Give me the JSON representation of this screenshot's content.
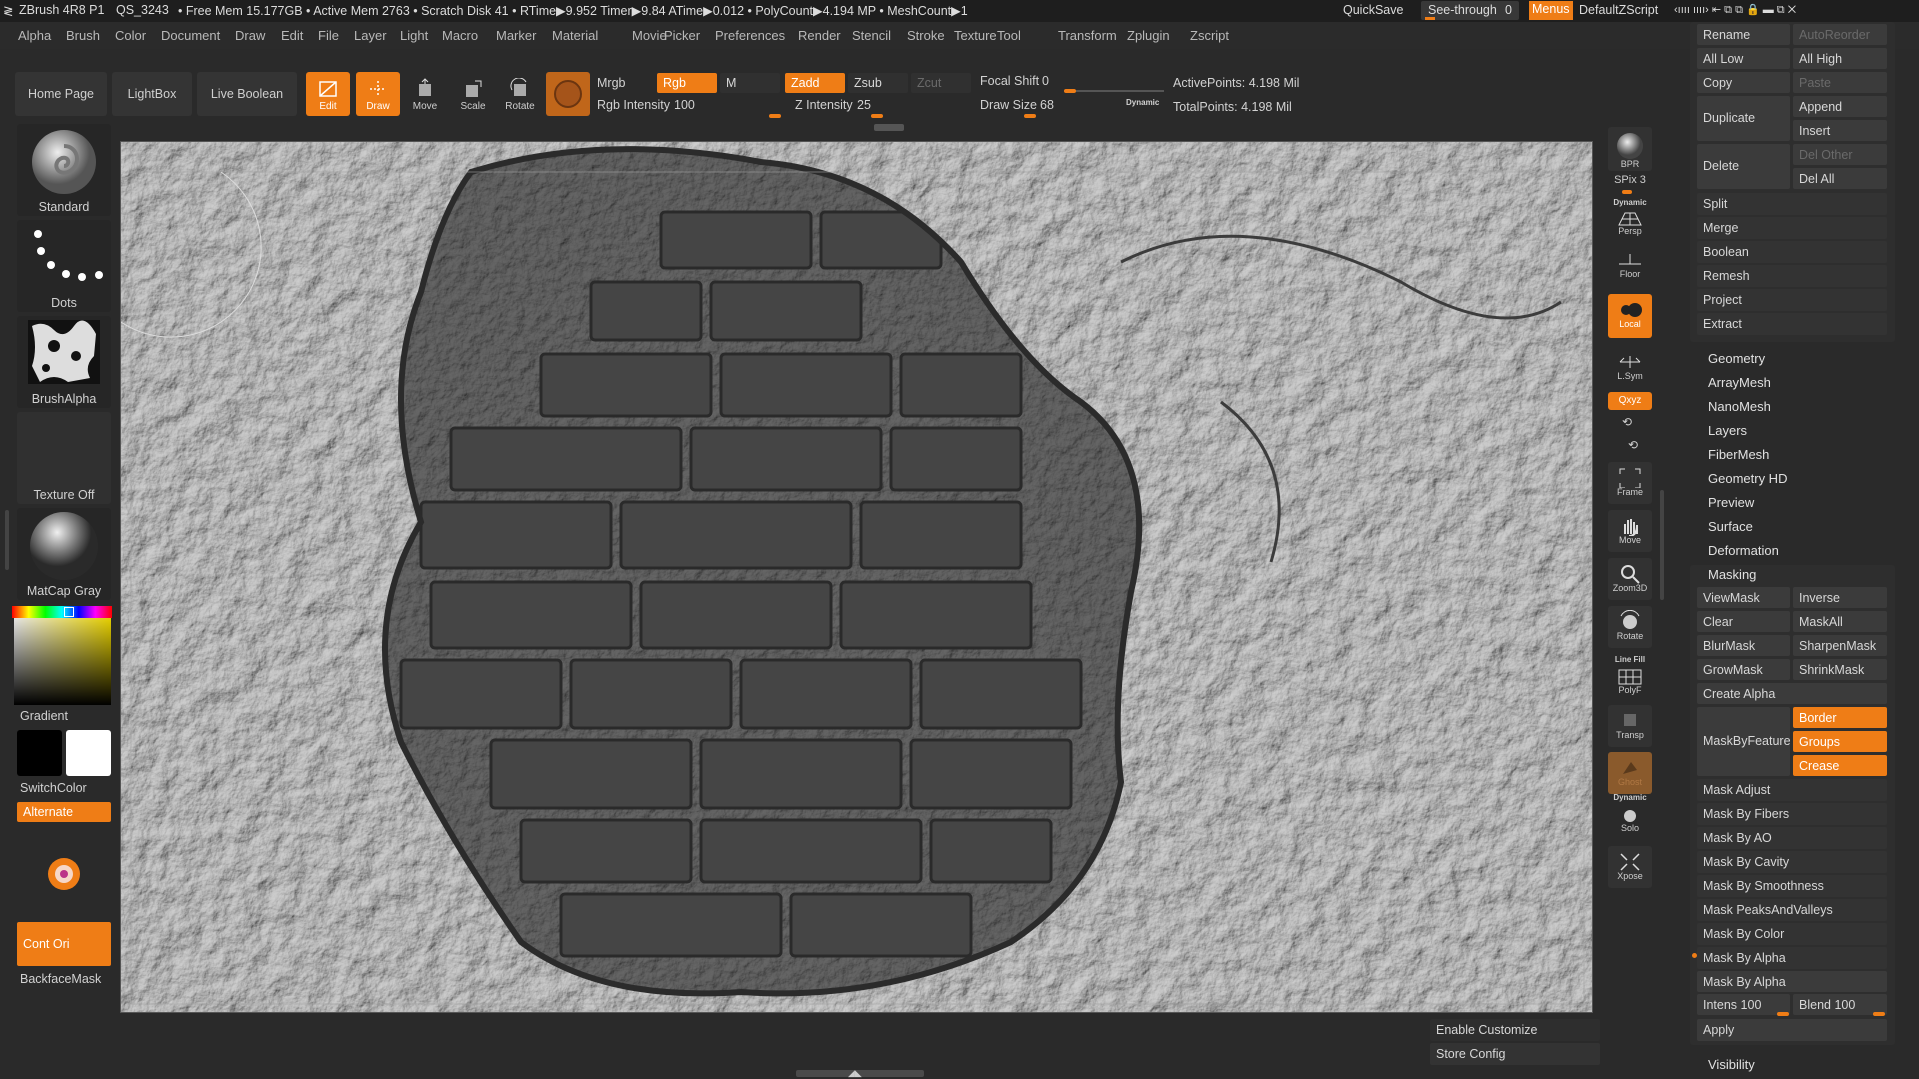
{
  "titlebar": {
    "app": "ZBrush 4R8 P1",
    "doc": "QS_3243",
    "stats": "• Free Mem 15.177GB • Active Mem 2763 • Scratch Disk 41 •  RTime▶9.952 Timer▶9.84 ATime▶0.012 • PolyCount▶4.194 MP  • MeshCount▶1",
    "quicksave": "QuickSave",
    "see_through_label": "See-through",
    "see_through_value": "0",
    "menus": "Menus",
    "script": "DefaultZScript"
  },
  "menubar": [
    "Alpha",
    "Brush",
    "Color",
    "Document",
    "Draw",
    "Edit",
    "File",
    "Layer",
    "Light",
    "Macro",
    "Marker",
    "Material",
    "Movie",
    "Picker",
    "Preferences",
    "Render",
    "Stencil",
    "Stroke",
    "Texture",
    "Tool",
    "Transform",
    "Zplugin",
    "Zscript"
  ],
  "toolbar": {
    "home_page": "Home Page",
    "lightbox": "LightBox",
    "live_boolean": "Live Boolean",
    "edit": "Edit",
    "draw": "Draw",
    "move": "Move",
    "scale": "Scale",
    "rotate": "Rotate",
    "mrgb": "Mrgb",
    "rgb": "Rgb",
    "m": "M",
    "rgb_intensity_label": "Rgb Intensity",
    "rgb_intensity_value": "100",
    "zadd": "Zadd",
    "zsub": "Zsub",
    "zcut": "Zcut",
    "z_intensity_label": "Z Intensity",
    "z_intensity_value": "25",
    "focal_shift_label": "Focal Shift",
    "focal_shift_value": "0",
    "draw_size_label": "Draw Size",
    "draw_size_value": "68",
    "dynamic": "Dynamic",
    "active_points": "ActivePoints: 4.198 Mil",
    "total_points": "TotalPoints: 4.198 Mil"
  },
  "left_shelf": {
    "brush": "Standard",
    "stroke": "Dots",
    "alpha": "BrushAlpha",
    "texture": "Texture Off",
    "material": "MatCap Gray",
    "gradient": "Gradient",
    "switchcolor": "SwitchColor",
    "alternate": "Alternate",
    "cont_ori": "Cont Ori",
    "backface": "BackfaceMask",
    "colors": {
      "primary": "#000000",
      "secondary": "#ffffff",
      "accent": "#ef7d16"
    }
  },
  "right_shelf": {
    "bpr": "BPR",
    "spix_label": "SPix",
    "spix_value": "3",
    "dynamic": "Dynamic",
    "persp": "Persp",
    "floor": "Floor",
    "local": "Local",
    "lsym": "L.Sym",
    "xyz": "Qxyz",
    "frame": "Frame",
    "move": "Move",
    "zoom3d": "Zoom3D",
    "rotate": "Rotate",
    "linefill": "Line Fill",
    "polyf": "PolyF",
    "transp": "Transp",
    "ghost": "Ghost",
    "dynamic2": "Dynamic",
    "solo": "Solo",
    "xpose": "Xpose"
  },
  "subtool": {
    "rename": "Rename",
    "autoreorder": "AutoReorder",
    "all_low": "All Low",
    "all_high": "All High",
    "copy": "Copy",
    "paste": "Paste",
    "duplicate": "Duplicate",
    "append": "Append",
    "insert": "Insert",
    "delete": "Delete",
    "del_other": "Del Other",
    "del_all": "Del All",
    "split": "Split",
    "merge": "Merge",
    "boolean": "Boolean",
    "remesh": "Remesh",
    "project": "Project",
    "extract": "Extract"
  },
  "sections": [
    "Geometry",
    "ArrayMesh",
    "NanoMesh",
    "Layers",
    "FiberMesh",
    "Geometry HD",
    "Preview",
    "Surface",
    "Deformation"
  ],
  "masking": {
    "title": "Masking",
    "viewmask": "ViewMask",
    "inverse": "Inverse",
    "clear": "Clear",
    "maskall": "MaskAll",
    "blurmask": "BlurMask",
    "sharpenmask": "SharpenMask",
    "growmask": "GrowMask",
    "shrinkmask": "ShrinkMask",
    "create_alpha": "Create Alpha",
    "maskbyfeature": "MaskByFeature",
    "border": "Border",
    "groups": "Groups",
    "crease": "Crease",
    "mask_adjust": "Mask Adjust",
    "by_fibers": "Mask By Fibers",
    "by_ao": "Mask By AO",
    "by_cavity": "Mask By Cavity",
    "by_smoothness": "Mask By Smoothness",
    "peaks": "Mask PeaksAndValleys",
    "by_color": "Mask By Color",
    "by_alpha": "Mask By Alpha",
    "by_alpha_btn": "Mask By Alpha",
    "intens_label": "Intens",
    "intens_value": "100",
    "blend_label": "Blend",
    "blend_value": "100",
    "apply": "Apply"
  },
  "visibility": "Visibility",
  "bottom": {
    "enable_customize": "Enable Customize",
    "store_config": "Store Config"
  }
}
